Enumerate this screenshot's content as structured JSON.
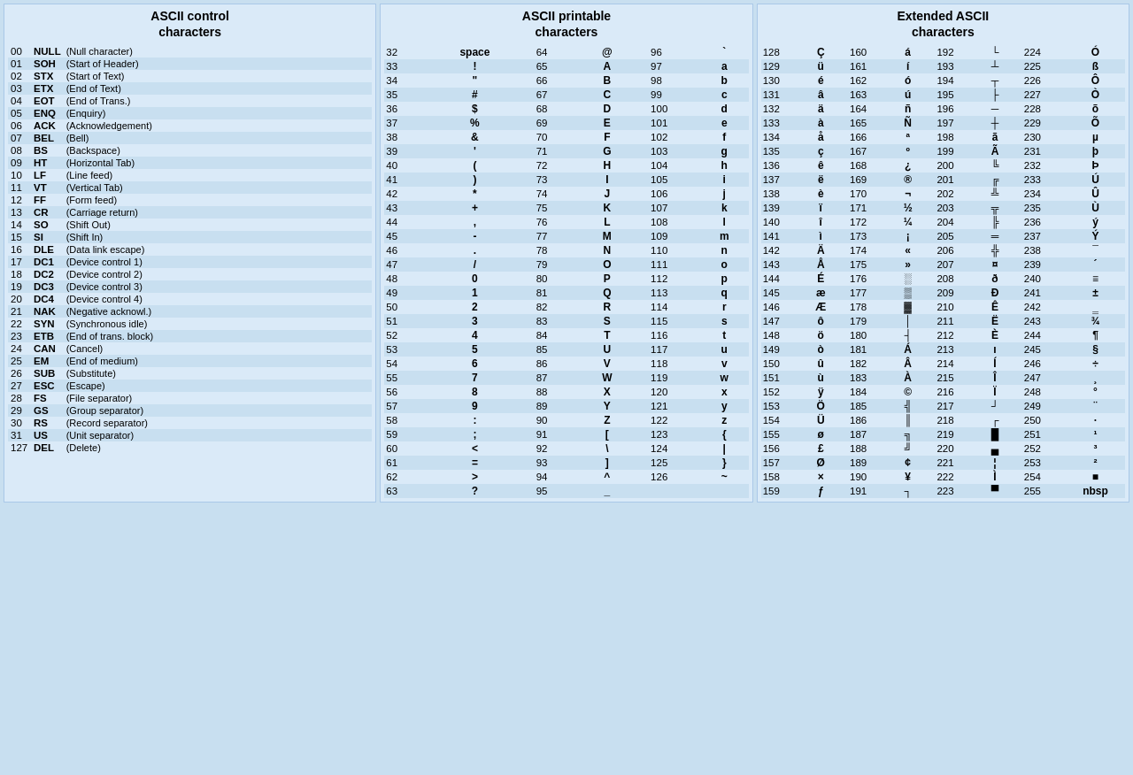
{
  "sections": {
    "control": {
      "title": "ASCII control\ncharacters",
      "rows": [
        {
          "num": "00",
          "code": "NULL",
          "desc": "(Null character)"
        },
        {
          "num": "01",
          "code": "SOH",
          "desc": "(Start of Header)"
        },
        {
          "num": "02",
          "code": "STX",
          "desc": "(Start of Text)"
        },
        {
          "num": "03",
          "code": "ETX",
          "desc": "(End of Text)"
        },
        {
          "num": "04",
          "code": "EOT",
          "desc": "(End of Trans.)"
        },
        {
          "num": "05",
          "code": "ENQ",
          "desc": "(Enquiry)"
        },
        {
          "num": "06",
          "code": "ACK",
          "desc": "(Acknowledgement)"
        },
        {
          "num": "07",
          "code": "BEL",
          "desc": "(Bell)"
        },
        {
          "num": "08",
          "code": "BS",
          "desc": "(Backspace)"
        },
        {
          "num": "09",
          "code": "HT",
          "desc": "(Horizontal Tab)"
        },
        {
          "num": "10",
          "code": "LF",
          "desc": "(Line feed)"
        },
        {
          "num": "11",
          "code": "VT",
          "desc": "(Vertical Tab)"
        },
        {
          "num": "12",
          "code": "FF",
          "desc": "(Form feed)"
        },
        {
          "num": "13",
          "code": "CR",
          "desc": "(Carriage return)"
        },
        {
          "num": "14",
          "code": "SO",
          "desc": "(Shift Out)"
        },
        {
          "num": "15",
          "code": "SI",
          "desc": "(Shift In)"
        },
        {
          "num": "16",
          "code": "DLE",
          "desc": "(Data link escape)"
        },
        {
          "num": "17",
          "code": "DC1",
          "desc": "(Device control 1)"
        },
        {
          "num": "18",
          "code": "DC2",
          "desc": "(Device control 2)"
        },
        {
          "num": "19",
          "code": "DC3",
          "desc": "(Device control 3)"
        },
        {
          "num": "20",
          "code": "DC4",
          "desc": "(Device control 4)"
        },
        {
          "num": "21",
          "code": "NAK",
          "desc": "(Negative acknowl.)"
        },
        {
          "num": "22",
          "code": "SYN",
          "desc": "(Synchronous idle)"
        },
        {
          "num": "23",
          "code": "ETB",
          "desc": "(End of trans. block)"
        },
        {
          "num": "24",
          "code": "CAN",
          "desc": "(Cancel)"
        },
        {
          "num": "25",
          "code": "EM",
          "desc": "(End of medium)"
        },
        {
          "num": "26",
          "code": "SUB",
          "desc": "(Substitute)"
        },
        {
          "num": "27",
          "code": "ESC",
          "desc": "(Escape)"
        },
        {
          "num": "28",
          "code": "FS",
          "desc": "(File separator)"
        },
        {
          "num": "29",
          "code": "GS",
          "desc": "(Group separator)"
        },
        {
          "num": "30",
          "code": "RS",
          "desc": "(Record separator)"
        },
        {
          "num": "31",
          "code": "US",
          "desc": "(Unit separator)"
        },
        {
          "num": "127",
          "code": "DEL",
          "desc": "(Delete)"
        }
      ]
    },
    "printable": {
      "title": "ASCII printable\ncharacters",
      "col1": [
        {
          "num": "32",
          "char": "space"
        },
        {
          "num": "33",
          "char": "!"
        },
        {
          "num": "34",
          "char": "\""
        },
        {
          "num": "35",
          "char": "#"
        },
        {
          "num": "36",
          "char": "$"
        },
        {
          "num": "37",
          "char": "%"
        },
        {
          "num": "38",
          "char": "&"
        },
        {
          "num": "39",
          "char": "'"
        },
        {
          "num": "40",
          "char": "("
        },
        {
          "num": "41",
          "char": ")"
        },
        {
          "num": "42",
          "char": "*"
        },
        {
          "num": "43",
          "char": "+"
        },
        {
          "num": "44",
          "char": ","
        },
        {
          "num": "45",
          "char": "-"
        },
        {
          "num": "46",
          "char": "."
        },
        {
          "num": "47",
          "char": "/"
        },
        {
          "num": "48",
          "char": "0"
        },
        {
          "num": "49",
          "char": "1"
        },
        {
          "num": "50",
          "char": "2"
        },
        {
          "num": "51",
          "char": "3"
        },
        {
          "num": "52",
          "char": "4"
        },
        {
          "num": "53",
          "char": "5"
        },
        {
          "num": "54",
          "char": "6"
        },
        {
          "num": "55",
          "char": "7"
        },
        {
          "num": "56",
          "char": "8"
        },
        {
          "num": "57",
          "char": "9"
        },
        {
          "num": "58",
          "char": ":"
        },
        {
          "num": "59",
          "char": ";"
        },
        {
          "num": "60",
          "char": "<"
        },
        {
          "num": "61",
          "char": "="
        },
        {
          "num": "62",
          "char": ">"
        },
        {
          "num": "63",
          "char": "?"
        }
      ],
      "col2": [
        {
          "num": "64",
          "char": "@"
        },
        {
          "num": "65",
          "char": "A"
        },
        {
          "num": "66",
          "char": "B"
        },
        {
          "num": "67",
          "char": "C"
        },
        {
          "num": "68",
          "char": "D"
        },
        {
          "num": "69",
          "char": "E"
        },
        {
          "num": "70",
          "char": "F"
        },
        {
          "num": "71",
          "char": "G"
        },
        {
          "num": "72",
          "char": "H"
        },
        {
          "num": "73",
          "char": "I"
        },
        {
          "num": "74",
          "char": "J"
        },
        {
          "num": "75",
          "char": "K"
        },
        {
          "num": "76",
          "char": "L"
        },
        {
          "num": "77",
          "char": "M"
        },
        {
          "num": "78",
          "char": "N"
        },
        {
          "num": "79",
          "char": "O"
        },
        {
          "num": "80",
          "char": "P"
        },
        {
          "num": "81",
          "char": "Q"
        },
        {
          "num": "82",
          "char": "R"
        },
        {
          "num": "83",
          "char": "S"
        },
        {
          "num": "84",
          "char": "T"
        },
        {
          "num": "85",
          "char": "U"
        },
        {
          "num": "86",
          "char": "V"
        },
        {
          "num": "87",
          "char": "W"
        },
        {
          "num": "88",
          "char": "X"
        },
        {
          "num": "89",
          "char": "Y"
        },
        {
          "num": "90",
          "char": "Z"
        },
        {
          "num": "91",
          "char": "["
        },
        {
          "num": "92",
          "char": "\\"
        },
        {
          "num": "93",
          "char": "]"
        },
        {
          "num": "94",
          "char": "^"
        },
        {
          "num": "95",
          "char": "_"
        }
      ],
      "col3": [
        {
          "num": "96",
          "char": "`"
        },
        {
          "num": "97",
          "char": "a"
        },
        {
          "num": "98",
          "char": "b"
        },
        {
          "num": "99",
          "char": "c"
        },
        {
          "num": "100",
          "char": "d"
        },
        {
          "num": "101",
          "char": "e"
        },
        {
          "num": "102",
          "char": "f"
        },
        {
          "num": "103",
          "char": "g"
        },
        {
          "num": "104",
          "char": "h"
        },
        {
          "num": "105",
          "char": "i"
        },
        {
          "num": "106",
          "char": "j"
        },
        {
          "num": "107",
          "char": "k"
        },
        {
          "num": "108",
          "char": "l"
        },
        {
          "num": "109",
          "char": "m"
        },
        {
          "num": "110",
          "char": "n"
        },
        {
          "num": "111",
          "char": "o"
        },
        {
          "num": "112",
          "char": "p"
        },
        {
          "num": "113",
          "char": "q"
        },
        {
          "num": "114",
          "char": "r"
        },
        {
          "num": "115",
          "char": "s"
        },
        {
          "num": "116",
          "char": "t"
        },
        {
          "num": "117",
          "char": "u"
        },
        {
          "num": "118",
          "char": "v"
        },
        {
          "num": "119",
          "char": "w"
        },
        {
          "num": "120",
          "char": "x"
        },
        {
          "num": "121",
          "char": "y"
        },
        {
          "num": "122",
          "char": "z"
        },
        {
          "num": "123",
          "char": "{"
        },
        {
          "num": "124",
          "char": "|"
        },
        {
          "num": "125",
          "char": "}"
        },
        {
          "num": "126",
          "char": "~"
        },
        {
          "num": "",
          "char": ""
        }
      ]
    },
    "extended": {
      "title": "Extended ASCII\ncharacters",
      "col1": [
        {
          "num": "128",
          "char": "Ç"
        },
        {
          "num": "129",
          "char": "ü"
        },
        {
          "num": "130",
          "char": "é"
        },
        {
          "num": "131",
          "char": "â"
        },
        {
          "num": "132",
          "char": "ä"
        },
        {
          "num": "133",
          "char": "à"
        },
        {
          "num": "134",
          "char": "å"
        },
        {
          "num": "135",
          "char": "ç"
        },
        {
          "num": "136",
          "char": "ê"
        },
        {
          "num": "137",
          "char": "ë"
        },
        {
          "num": "138",
          "char": "è"
        },
        {
          "num": "139",
          "char": "ï"
        },
        {
          "num": "140",
          "char": "î"
        },
        {
          "num": "141",
          "char": "ì"
        },
        {
          "num": "142",
          "char": "Ä"
        },
        {
          "num": "143",
          "char": "Å"
        },
        {
          "num": "144",
          "char": "É"
        },
        {
          "num": "145",
          "char": "æ"
        },
        {
          "num": "146",
          "char": "Æ"
        },
        {
          "num": "147",
          "char": "ô"
        },
        {
          "num": "148",
          "char": "ö"
        },
        {
          "num": "149",
          "char": "ò"
        },
        {
          "num": "150",
          "char": "û"
        },
        {
          "num": "151",
          "char": "ù"
        },
        {
          "num": "152",
          "char": "ÿ"
        },
        {
          "num": "153",
          "char": "Ö"
        },
        {
          "num": "154",
          "char": "Ü"
        },
        {
          "num": "155",
          "char": "ø"
        },
        {
          "num": "156",
          "char": "£"
        },
        {
          "num": "157",
          "char": "Ø"
        },
        {
          "num": "158",
          "char": "×"
        },
        {
          "num": "159",
          "char": "ƒ"
        }
      ],
      "col2": [
        {
          "num": "160",
          "char": "á"
        },
        {
          "num": "161",
          "char": "í"
        },
        {
          "num": "162",
          "char": "ó"
        },
        {
          "num": "163",
          "char": "ú"
        },
        {
          "num": "164",
          "char": "ñ"
        },
        {
          "num": "165",
          "char": "Ñ"
        },
        {
          "num": "166",
          "char": "ª"
        },
        {
          "num": "167",
          "char": "º"
        },
        {
          "num": "168",
          "char": "¿"
        },
        {
          "num": "169",
          "char": "®"
        },
        {
          "num": "170",
          "char": "¬"
        },
        {
          "num": "171",
          "char": "½"
        },
        {
          "num": "172",
          "char": "¼"
        },
        {
          "num": "173",
          "char": "¡"
        },
        {
          "num": "174",
          "char": "«"
        },
        {
          "num": "175",
          "char": "»"
        },
        {
          "num": "176",
          "char": "░"
        },
        {
          "num": "177",
          "char": "▒"
        },
        {
          "num": "178",
          "char": "▓"
        },
        {
          "num": "179",
          "char": "│"
        },
        {
          "num": "180",
          "char": "┤"
        },
        {
          "num": "181",
          "char": "Á"
        },
        {
          "num": "182",
          "char": "Â"
        },
        {
          "num": "183",
          "char": "À"
        },
        {
          "num": "184",
          "char": "©"
        },
        {
          "num": "185",
          "char": "╣"
        },
        {
          "num": "186",
          "char": "║"
        },
        {
          "num": "187",
          "char": "╗"
        },
        {
          "num": "188",
          "char": "╝"
        },
        {
          "num": "189",
          "char": "¢"
        },
        {
          "num": "190",
          "char": "¥"
        },
        {
          "num": "191",
          "char": "┐"
        }
      ],
      "col3": [
        {
          "num": "192",
          "char": "└"
        },
        {
          "num": "193",
          "char": "┴"
        },
        {
          "num": "194",
          "char": "┬"
        },
        {
          "num": "195",
          "char": "├"
        },
        {
          "num": "196",
          "char": "─"
        },
        {
          "num": "197",
          "char": "┼"
        },
        {
          "num": "198",
          "char": "ã"
        },
        {
          "num": "199",
          "char": "Ã"
        },
        {
          "num": "200",
          "char": "╚"
        },
        {
          "num": "201",
          "char": "╔"
        },
        {
          "num": "202",
          "char": "╩"
        },
        {
          "num": "203",
          "char": "╦"
        },
        {
          "num": "204",
          "char": "╠"
        },
        {
          "num": "205",
          "char": "═"
        },
        {
          "num": "206",
          "char": "╬"
        },
        {
          "num": "207",
          "char": "¤"
        },
        {
          "num": "208",
          "char": "ð"
        },
        {
          "num": "209",
          "char": "Ð"
        },
        {
          "num": "210",
          "char": "Ê"
        },
        {
          "num": "211",
          "char": "Ë"
        },
        {
          "num": "212",
          "char": "È"
        },
        {
          "num": "213",
          "char": "ı"
        },
        {
          "num": "214",
          "char": "Í"
        },
        {
          "num": "215",
          "char": "Î"
        },
        {
          "num": "216",
          "char": "Ï"
        },
        {
          "num": "217",
          "char": "┘"
        },
        {
          "num": "218",
          "char": "┌"
        },
        {
          "num": "219",
          "char": "█"
        },
        {
          "num": "220",
          "char": "▄"
        },
        {
          "num": "221",
          "char": "¦"
        },
        {
          "num": "222",
          "char": "Ì"
        },
        {
          "num": "223",
          "char": "▀"
        }
      ],
      "col4": [
        {
          "num": "224",
          "char": "Ó"
        },
        {
          "num": "225",
          "char": "ß"
        },
        {
          "num": "226",
          "char": "Ô"
        },
        {
          "num": "227",
          "char": "Ò"
        },
        {
          "num": "228",
          "char": "õ"
        },
        {
          "num": "229",
          "char": "Õ"
        },
        {
          "num": "230",
          "char": "µ"
        },
        {
          "num": "231",
          "char": "þ"
        },
        {
          "num": "232",
          "char": "Þ"
        },
        {
          "num": "233",
          "char": "Ú"
        },
        {
          "num": "234",
          "char": "Û"
        },
        {
          "num": "235",
          "char": "Ù"
        },
        {
          "num": "236",
          "char": "ý"
        },
        {
          "num": "237",
          "char": "Ý"
        },
        {
          "num": "238",
          "char": "¯"
        },
        {
          "num": "239",
          "char": "´"
        },
        {
          "num": "240",
          "char": "≡"
        },
        {
          "num": "241",
          "char": "±"
        },
        {
          "num": "242",
          "char": "‗"
        },
        {
          "num": "243",
          "char": "¾"
        },
        {
          "num": "244",
          "char": "¶"
        },
        {
          "num": "245",
          "char": "§"
        },
        {
          "num": "246",
          "char": "÷"
        },
        {
          "num": "247",
          "char": "¸"
        },
        {
          "num": "248",
          "char": "°"
        },
        {
          "num": "249",
          "char": "¨"
        },
        {
          "num": "250",
          "char": "·"
        },
        {
          "num": "251",
          "char": "¹"
        },
        {
          "num": "252",
          "char": "³"
        },
        {
          "num": "253",
          "char": "²"
        },
        {
          "num": "254",
          "char": "■"
        },
        {
          "num": "255",
          "char": "nbsp"
        }
      ]
    }
  }
}
